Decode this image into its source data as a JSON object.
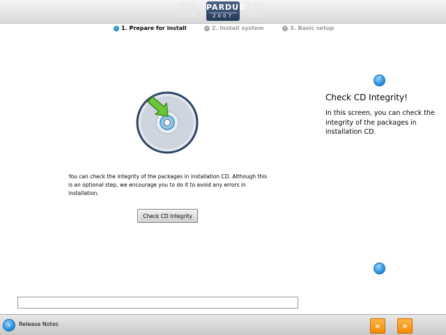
{
  "header": {
    "logo_line1": "PARDUS",
    "logo_line2": "2007"
  },
  "steps": [
    {
      "label": "1. Prepare for install",
      "state": "active"
    },
    {
      "label": "2. Install system",
      "state": "inactive"
    },
    {
      "label": "3. Basic setup",
      "state": "inactive"
    }
  ],
  "main": {
    "illustration_icon": "cd-with-arrow-icon",
    "description": "You can check the integrity of the packages in installation CD. Although this is an optional step, we encourage you to do it to avoid any errors in installation.",
    "check_button_label": "Check CD Integrity"
  },
  "help": {
    "title": "Check CD Integrity!",
    "body": "In this screen, you can check the integrity of the packages in installation CD."
  },
  "footer": {
    "release_notes_label": "Release Notes",
    "back_icon": "double-chevron-left-icon",
    "next_icon": "double-chevron-right-icon"
  },
  "colors": {
    "accent_blue": "#1f86d6",
    "nav_orange": "#f38a00",
    "logo_blue": "#25395a"
  }
}
